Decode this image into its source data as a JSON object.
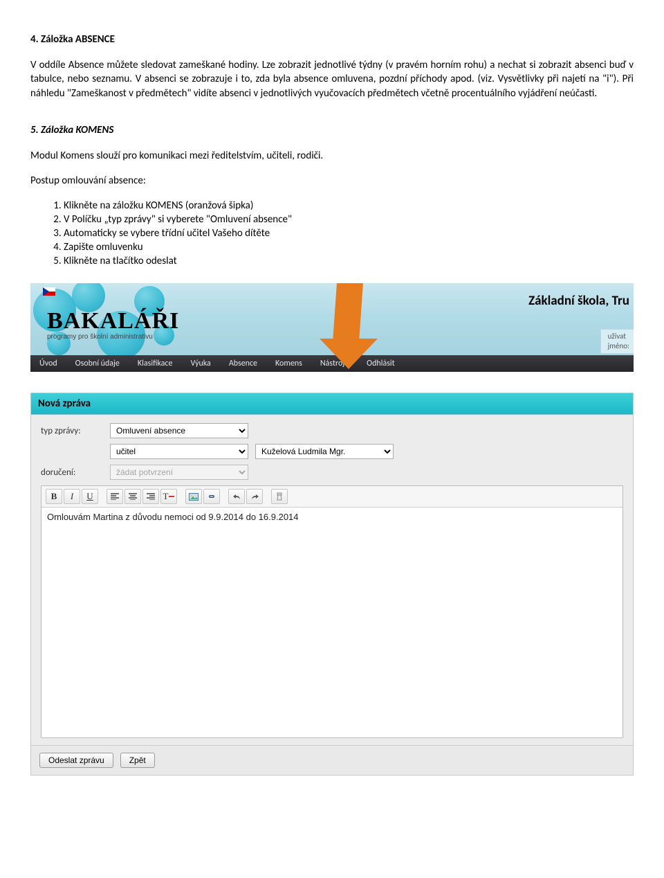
{
  "section4": {
    "heading": "4.   Záložka ABSENCE",
    "p1": "V oddíle Absence můžete sledovat zameškané hodiny. Lze zobrazit jednotlivé týdny (v pravém horním rohu) a nechat si zobrazit absenci buď v tabulce, nebo seznamu. V absenci se zobrazuje i to, zda byla absence omluvena, pozdní příchody apod. (viz. Vysvětlivky při najetí na \"i\"). Při náhledu \"Zameškanost v předmětech\" vidíte absenci v jednotlivých vyučovacích předmětech včetně procentuálního vyjádření neúčasti."
  },
  "section5": {
    "heading": "5.   Záložka KOMENS",
    "intro": "Modul Komens slouží pro komunikaci mezi ředitelstvím, učiteli, rodiči.",
    "steps_title": "Postup omlouvání absence:",
    "steps": [
      "Klikněte na záložku KOMENS (oranžová šipka)",
      "V Políčku „typ zprávy\" si vyberete \"Omluvení absence\"",
      "Automaticky se vybere třídní učitel Vašeho dítěte",
      "Zapište omluvenku",
      "Klikněte na tlačítko odeslat"
    ]
  },
  "banner": {
    "logo": "BAKALÁŘI",
    "logo_sub": "programy pro školní administrativu",
    "school": "Základní škola, Tru",
    "user_l1": "uživat",
    "user_l2": "jméno:"
  },
  "menu": [
    "Úvod",
    "Osobní údaje",
    "Klasifikace",
    "Výuka",
    "Absence",
    "Komens",
    "Nástroje",
    "Odhlásit"
  ],
  "form": {
    "title": "Nová zpráva",
    "lbl_type": "typ zprávy:",
    "lbl_deliv": "doručení:",
    "type_value": "Omluvení absence",
    "role_value": "učitel",
    "teacher_value": "Kuželová Ludmila Mgr.",
    "deliv_value": "žádat potvrzení",
    "message": "Omlouvám Martina z důvodu nemoci od 9.9.2014 do 16.9.2014",
    "btn_send": "Odeslat zprávu",
    "btn_back": "Zpět"
  },
  "toolbar_icons": [
    "B",
    "I",
    "U",
    "align-left",
    "align-center",
    "align-right",
    "text-color",
    "image",
    "link",
    "undo",
    "redo",
    "remove-format"
  ]
}
